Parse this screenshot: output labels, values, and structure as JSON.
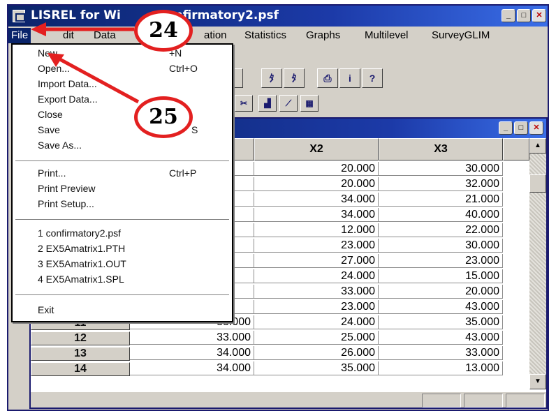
{
  "window": {
    "title": "LISREL for Wi",
    "title_tail": "- confirmatory2.psf"
  },
  "menubar": {
    "items": [
      "File",
      "dit",
      "Data",
      "ation",
      "Statistics",
      "Graphs",
      "Multilevel",
      "SurveyGLIM"
    ]
  },
  "file_menu": {
    "items": [
      {
        "label": "New",
        "shortcut": "+N"
      },
      {
        "label": "Open...",
        "shortcut": "Ctrl+O"
      },
      {
        "label": "Import Data..."
      },
      {
        "label": "Export Data..."
      },
      {
        "label": "Close"
      },
      {
        "label": "Save",
        "shortcut": "S"
      },
      {
        "label": "Save As..."
      },
      {
        "label": "Print...",
        "shortcut": "Ctrl+P"
      },
      {
        "label": "Print Preview"
      },
      {
        "label": "Print Setup..."
      },
      {
        "label": "1 confirmatory2.psf"
      },
      {
        "label": "2 EX5Amatrix1.PTH"
      },
      {
        "label": "3 EX5Amatrix1.OUT"
      },
      {
        "label": "4 EX5Amatrix1.SPL"
      },
      {
        "label": "Exit"
      }
    ]
  },
  "annotations": {
    "step_24": "24",
    "step_25": "25"
  },
  "grid": {
    "columns": [
      "X2",
      "X3"
    ],
    "row_labels": [
      "11",
      "12",
      "13",
      "14"
    ],
    "col1_partial": [
      "33.000",
      "33.000",
      "34.000",
      "34.000"
    ],
    "x2": [
      "20.000",
      "20.000",
      "34.000",
      "34.000",
      "12.000",
      "23.000",
      "27.000",
      "24.000",
      "33.000",
      "23.000",
      "24.000",
      "25.000",
      "26.000",
      "35.000"
    ],
    "x3": [
      "30.000",
      "32.000",
      "21.000",
      "40.000",
      "22.000",
      "30.000",
      "23.000",
      "15.000",
      "20.000",
      "43.000",
      "35.000",
      "43.000",
      "33.000",
      "13.000"
    ]
  },
  "colors": {
    "title_bar": "#0a246a",
    "callout": "#e32020",
    "face": "#d4d0c8"
  }
}
